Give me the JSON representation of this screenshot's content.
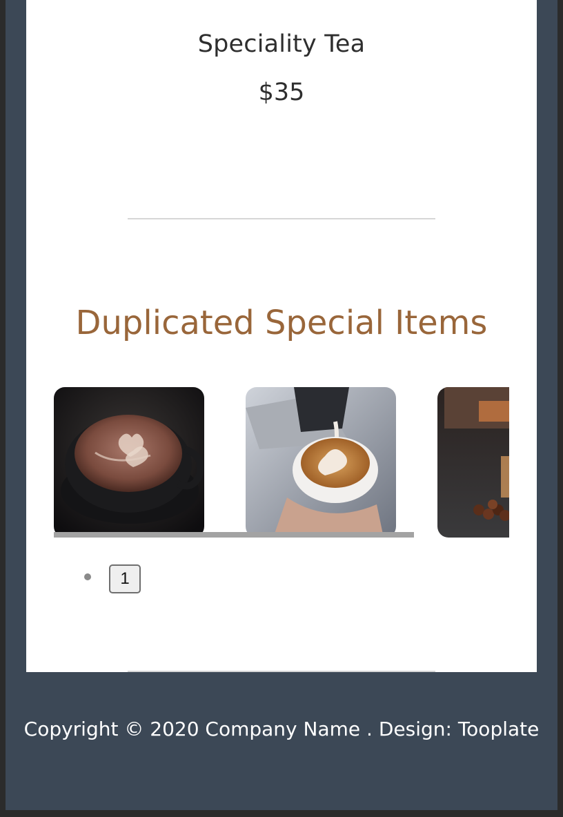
{
  "menu_item": {
    "name": "Speciality Tea",
    "price": "$35"
  },
  "special_section": {
    "title": "Duplicated Special Items",
    "cards": [
      {
        "image": "latte-art-hearts-photo"
      },
      {
        "image": "latte-pouring-photo"
      },
      {
        "image": "coffee-beans-photo"
      }
    ],
    "pager": {
      "page_label": "1"
    }
  },
  "footer": {
    "copyright": "Copyright © 2020 Company Name . Design: Tooplate"
  },
  "colors": {
    "accent": "#99663a",
    "footer_bg": "#3c4856",
    "content_bg": "#ffffff"
  }
}
